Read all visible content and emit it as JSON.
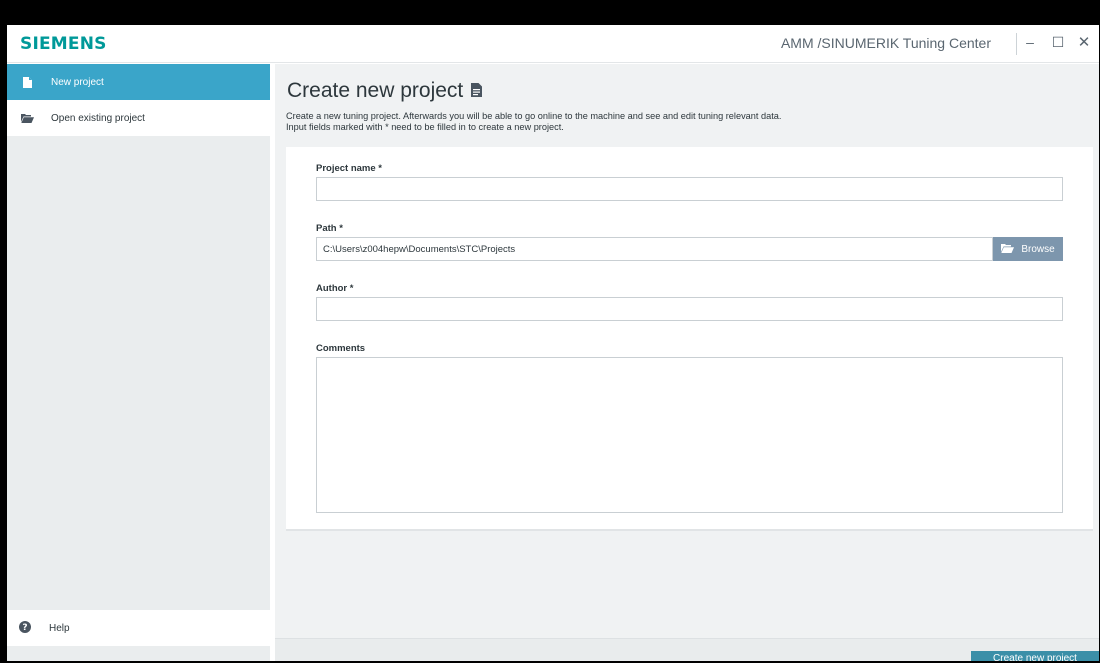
{
  "window": {
    "logo": "SIEMENS",
    "app_title": "AMM /SINUMERIK Tuning Center",
    "minimize_glyph": "–",
    "maximize_glyph": "☐",
    "close_glyph": "✕"
  },
  "sidebar": {
    "items": [
      {
        "label": "New project",
        "icon": "file-icon",
        "active": true
      },
      {
        "label": "Open existing project",
        "icon": "folder-open-icon",
        "active": false
      }
    ],
    "help": {
      "label": "Help",
      "icon": "help-circle-icon"
    }
  },
  "main": {
    "title": "Create new project",
    "title_icon": "document-icon",
    "description_line1": "Create a new tuning project. Afterwards you will be able to go online to the machine and see and edit tuning relevant data.",
    "description_line2": "Input fields marked with * need to be filled in to create a new project."
  },
  "form": {
    "project_name": {
      "label": "Project name *",
      "value": ""
    },
    "path": {
      "label": "Path *",
      "value": "C:\\Users\\z004hepw\\Documents\\STC\\Projects"
    },
    "browse_label": "Browse",
    "author": {
      "label": "Author *",
      "value": ""
    },
    "comments": {
      "label": "Comments",
      "value": ""
    }
  },
  "footer": {
    "create_button_label": "Create new project"
  },
  "colors": {
    "brand": "#009999",
    "active_nav": "#3aa5c9",
    "browse_button": "#7d96ad",
    "primary_button": "#3b8fa8"
  }
}
